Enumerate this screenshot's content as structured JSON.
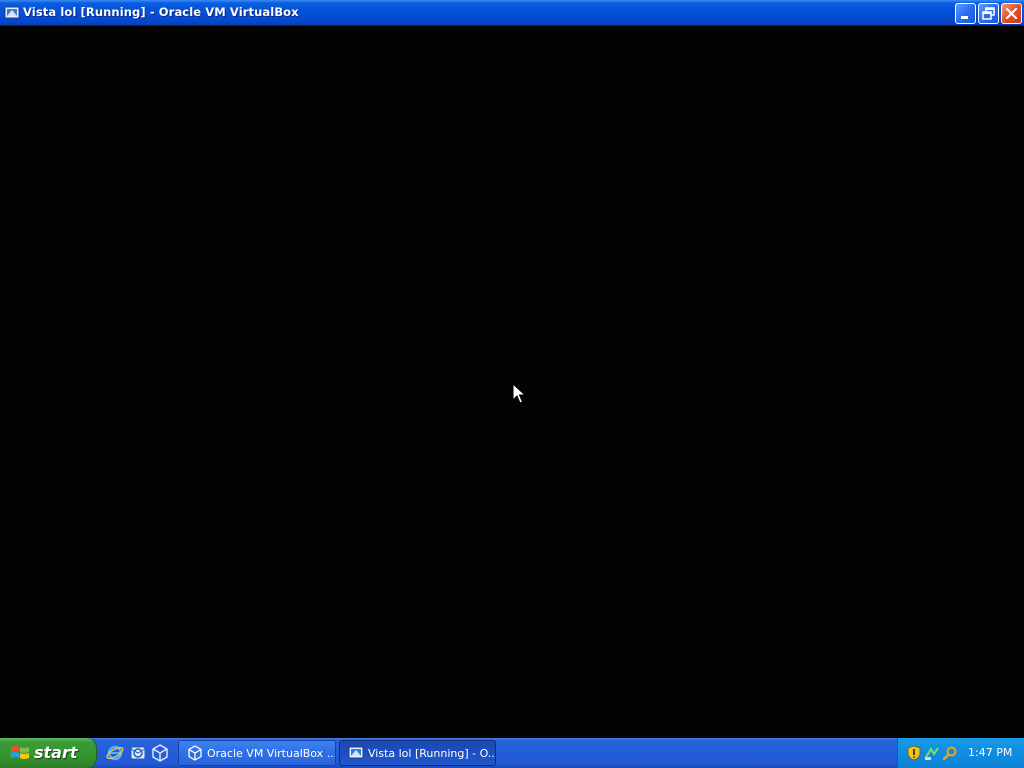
{
  "window": {
    "title": "Vista lol [Running] - Oracle VM VirtualBox",
    "icon": "virtualbox-vm-icon",
    "controls": [
      "minimize-icon",
      "restore-icon",
      "close-icon"
    ]
  },
  "vm_screen": {
    "background": "#020202",
    "cursor": "arrow-cursor-icon"
  },
  "taskbar": {
    "start_label": "start",
    "quick_launch": [
      "internet-explorer-icon",
      "outlook-express-icon",
      "virtualbox-icon"
    ],
    "tasks": [
      {
        "label": "Oracle VM VirtualBox ...",
        "icon": "virtualbox-icon",
        "active": false
      },
      {
        "label": "Vista lol [Running] - O...",
        "icon": "virtualbox-vm-icon",
        "active": true
      }
    ],
    "tray_icons": [
      "security-shield-icon",
      "network-icon",
      "search-icon"
    ],
    "clock": "1:47 PM"
  },
  "colors": {
    "titlebar_blue": "#0450d8",
    "taskbar_blue": "#245edb",
    "start_green": "#35952f",
    "tray_blue": "#108fe0",
    "close_red": "#e0502a"
  }
}
